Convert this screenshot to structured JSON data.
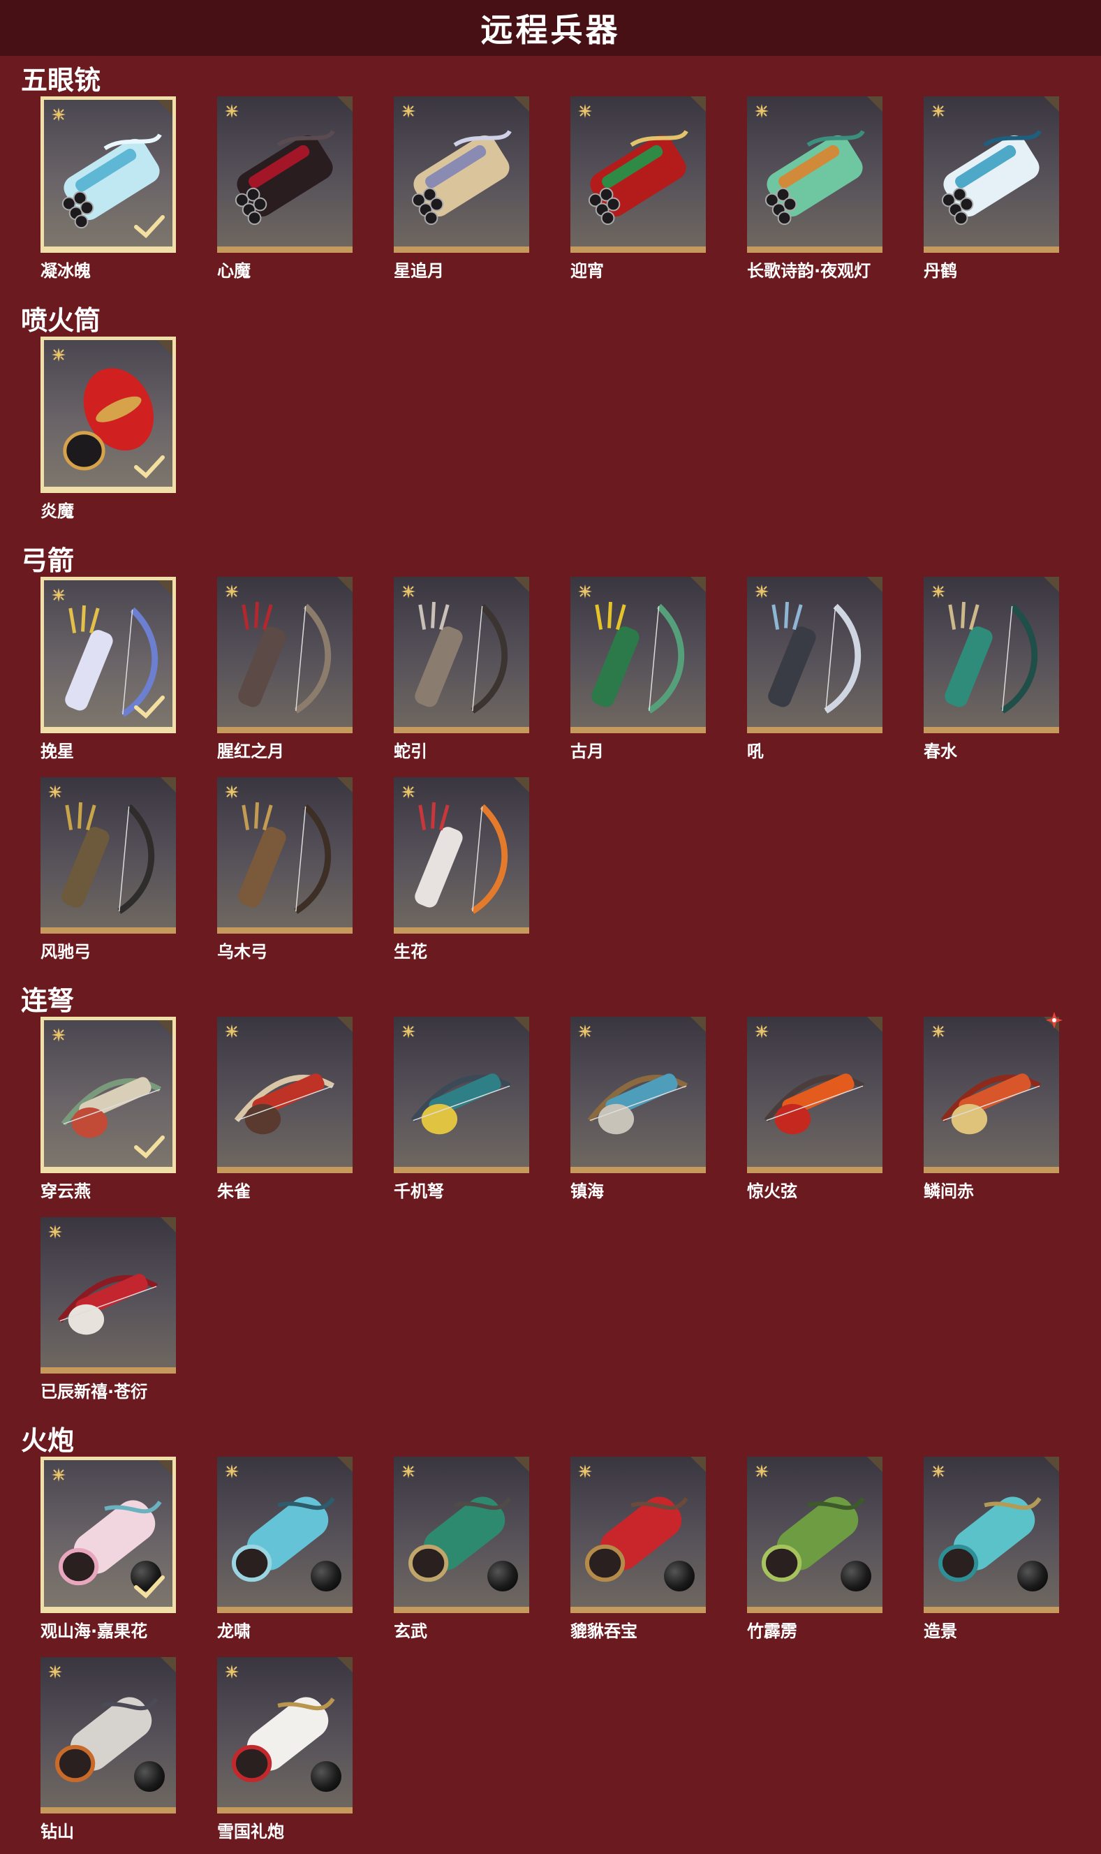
{
  "page_title": "远程兵器",
  "colors": {
    "background": "#6b1a1f",
    "header": "#461014",
    "card_border": "#c69a5c",
    "selected_border": "#f0dfa8",
    "rarity_star": "#e8c36a"
  },
  "sections": [
    {
      "title": "五眼铳",
      "items": [
        {
          "name": "凝冰魄",
          "selected": true,
          "palette": [
            "#bfe8f2",
            "#5fb7d6",
            "#e9f6fb"
          ]
        },
        {
          "name": "心魔",
          "palette": [
            "#2a1d20",
            "#a31628",
            "#5a4b50"
          ]
        },
        {
          "name": "星追月",
          "palette": [
            "#d9c49b",
            "#8a8bb3",
            "#d0d0e6"
          ]
        },
        {
          "name": "迎宵",
          "palette": [
            "#b41c1c",
            "#2f8a45",
            "#e2c36b"
          ]
        },
        {
          "name": "长歌诗韵·夜观灯",
          "palette": [
            "#6fc7a2",
            "#d08a3a",
            "#3d8f7d"
          ]
        },
        {
          "name": "丹鹤",
          "palette": [
            "#e5f1f6",
            "#4ea9c8",
            "#1e5f7f"
          ]
        }
      ]
    },
    {
      "title": "喷火筒",
      "items": [
        {
          "name": "炎魔",
          "selected": true,
          "palette": [
            "#d0201f",
            "#d6a24a",
            "#1c1a1c"
          ]
        }
      ]
    },
    {
      "title": "弓箭",
      "items": [
        {
          "name": "挽星",
          "selected": true,
          "palette": [
            "#dfe0f3",
            "#e3c04a",
            "#6d7fd1"
          ]
        },
        {
          "name": "腥红之月",
          "palette": [
            "#5c4a46",
            "#b3282f",
            "#8b7c6b"
          ]
        },
        {
          "name": "蛇引",
          "palette": [
            "#8a7c6e",
            "#c9c1b7",
            "#3b3431"
          ]
        },
        {
          "name": "古月",
          "palette": [
            "#2c7a4a",
            "#e7c32a",
            "#55a07b"
          ]
        },
        {
          "name": "吼",
          "palette": [
            "#3a3c45",
            "#8fb6d6",
            "#cfd6e2"
          ]
        },
        {
          "name": "春水",
          "palette": [
            "#2f8c7b",
            "#cdb98a",
            "#1f4f48"
          ]
        },
        {
          "name": "风驰弓",
          "palette": [
            "#6d5a3c",
            "#c8a548",
            "#2e2d2b"
          ]
        },
        {
          "name": "乌木弓",
          "palette": [
            "#7a5a3a",
            "#c39b52",
            "#3d2f25"
          ]
        },
        {
          "name": "生花",
          "palette": [
            "#e7e2df",
            "#c9363b",
            "#e47a2c"
          ]
        }
      ]
    },
    {
      "title": "连弩",
      "items": [
        {
          "name": "穿云燕",
          "selected": true,
          "palette": [
            "#d9cfb8",
            "#c14b36",
            "#7a9a7c"
          ]
        },
        {
          "name": "朱雀",
          "palette": [
            "#bf3326",
            "#5a3a2e",
            "#d8c6a7"
          ]
        },
        {
          "name": "千机弩",
          "palette": [
            "#2e7f86",
            "#e1c342",
            "#3c4a58"
          ]
        },
        {
          "name": "镇海",
          "palette": [
            "#4d9dbb",
            "#c8c3b8",
            "#8a6a3e"
          ]
        },
        {
          "name": "惊火弦",
          "palette": [
            "#e35b1d",
            "#c4281e",
            "#4a3d3c"
          ]
        },
        {
          "name": "鳞间赤",
          "new": true,
          "palette": [
            "#d9562b",
            "#e0c37a",
            "#8d2a1c"
          ]
        },
        {
          "name": "已辰新禧·苍衍",
          "palette": [
            "#c4262f",
            "#e8e2dc",
            "#8b1a23"
          ]
        }
      ]
    },
    {
      "title": "火炮",
      "items": [
        {
          "name": "观山海·嘉果花",
          "selected": true,
          "ball": true,
          "palette": [
            "#f1d5df",
            "#e8a7bf",
            "#6ab2c0"
          ]
        },
        {
          "name": "龙啸",
          "ball": true,
          "palette": [
            "#64c3d6",
            "#9ad6e2",
            "#2d5d6d"
          ]
        },
        {
          "name": "玄武",
          "ball": true,
          "palette": [
            "#2e8a6e",
            "#c1a66b",
            "#4e4b48"
          ]
        },
        {
          "name": "貔貅吞宝",
          "ball": true,
          "palette": [
            "#c9262c",
            "#b58b4a",
            "#6a4a3a"
          ]
        },
        {
          "name": "竹霹雳",
          "ball": true,
          "palette": [
            "#6e9c42",
            "#a7c35e",
            "#3c5a2a"
          ]
        },
        {
          "name": "造景",
          "ball": true,
          "palette": [
            "#5cc2c9",
            "#2f8f96",
            "#b39b57"
          ]
        },
        {
          "name": "钻山",
          "ball": true,
          "palette": [
            "#d6d3cf",
            "#c86b2a",
            "#4b4a55"
          ]
        },
        {
          "name": "雪国礼炮",
          "ball": true,
          "palette": [
            "#f1f0ec",
            "#c3292c",
            "#b9954e"
          ]
        }
      ]
    }
  ]
}
